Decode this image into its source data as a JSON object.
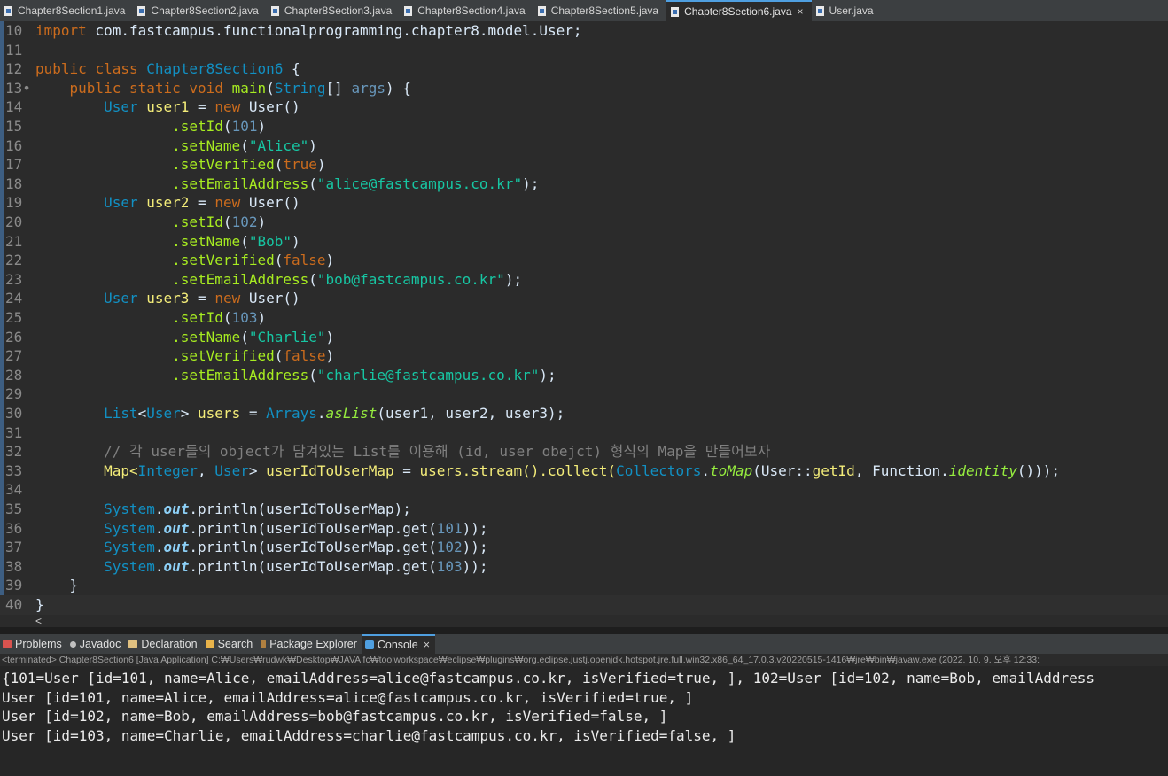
{
  "tabs": [
    {
      "label": "Chapter8Section1.java",
      "active": false
    },
    {
      "label": "Chapter8Section2.java",
      "active": false
    },
    {
      "label": "Chapter8Section3.java",
      "active": false
    },
    {
      "label": "Chapter8Section4.java",
      "active": false
    },
    {
      "label": "Chapter8Section5.java",
      "active": false
    },
    {
      "label": "Chapter8Section6.java",
      "active": true,
      "close": "×"
    },
    {
      "label": "User.java",
      "active": false
    }
  ],
  "editor": {
    "line_numbers": [
      "10",
      "11",
      "12",
      "13•",
      "14",
      "15",
      "16",
      "17",
      "18",
      "19",
      "20",
      "21",
      "22",
      "23",
      "24",
      "25",
      "26",
      "27",
      "28",
      "29",
      "30",
      "31",
      "32",
      "33",
      "34",
      "35",
      "36",
      "37",
      "38",
      "39",
      "40"
    ],
    "code": {
      "l10": {
        "kw": "import",
        "rest": " com.fastcampus.functionalprogramming.chapter8.model.User;"
      },
      "l12": {
        "kw1": "public",
        "kw2": "class",
        "cls": "Chapter8Section6",
        "brace": " {"
      },
      "l13": {
        "kw1": "public",
        "kw2": "static",
        "kw3": "void",
        "meth": "main",
        "p1": "(",
        "cls": "String",
        "p2": "[] ",
        "arg": "args",
        "p3": ") {"
      },
      "l14": {
        "cls": "User",
        "var": "user1",
        "eq": " = ",
        "kw": "new",
        "rest": " User()"
      },
      "l15": {
        "meth": ".setId",
        "p1": "(",
        "num": "101",
        "p2": ")"
      },
      "l16": {
        "meth": ".setName",
        "p1": "(",
        "str": "\"Alice\"",
        "p2": ")"
      },
      "l17": {
        "meth": ".setVerified",
        "p1": "(",
        "kw": "true",
        "p2": ")"
      },
      "l18": {
        "meth": ".setEmailAddress",
        "p1": "(",
        "str": "\"alice@fastcampus.co.kr\"",
        "p2": ");"
      },
      "l19": {
        "cls": "User",
        "var": "user2",
        "eq": " = ",
        "kw": "new",
        "rest": " User()"
      },
      "l20": {
        "meth": ".setId",
        "p1": "(",
        "num": "102",
        "p2": ")"
      },
      "l21": {
        "meth": ".setName",
        "p1": "(",
        "str": "\"Bob\"",
        "p2": ")"
      },
      "l22": {
        "meth": ".setVerified",
        "p1": "(",
        "kw": "false",
        "p2": ")"
      },
      "l23": {
        "meth": ".setEmailAddress",
        "p1": "(",
        "str": "\"bob@fastcampus.co.kr\"",
        "p2": ");"
      },
      "l24": {
        "cls": "User",
        "var": "user3",
        "eq": " = ",
        "kw": "new",
        "rest": " User()"
      },
      "l25": {
        "meth": ".setId",
        "p1": "(",
        "num": "103",
        "p2": ")"
      },
      "l26": {
        "meth": ".setName",
        "p1": "(",
        "str": "\"Charlie\"",
        "p2": ")"
      },
      "l27": {
        "meth": ".setVerified",
        "p1": "(",
        "kw": "false",
        "p2": ")"
      },
      "l28": {
        "meth": ".setEmailAddress",
        "p1": "(",
        "str": "\"charlie@fastcampus.co.kr\"",
        "p2": ");"
      },
      "l30": {
        "cls1": "List",
        "lt": "<",
        "cls2": "User",
        "gt": "> ",
        "var": "users",
        "eq": " = ",
        "cls3": "Arrays",
        "dot": ".",
        "smeth": "asList",
        "rest": "(user1, user2, user3);"
      },
      "l32": {
        "comment": "// 각 user들의 object가 담겨있는 List를 이용해 (id, user obejct) 형식의 Map을 만들어보자"
      },
      "l33": {
        "t1": "Map<",
        "cls1": "Integer",
        "t2": ", ",
        "cls2": "User",
        "t3": "> ",
        "var": "userIdToUserMap",
        "t4": " = ",
        "t5": "users.stream().collect(",
        "cls3": "Collectors",
        "dot": ".",
        "smeth": "toMap",
        "t6": "(User::",
        "meth": "getId",
        "t7": ", Function.",
        "smeth2": "identity",
        "t8": "()));"
      },
      "l35": {
        "cls": "System",
        "dot": ".",
        "field": "out",
        "rest": ".println(userIdToUserMap);"
      },
      "l36": {
        "cls": "System",
        "dot": ".",
        "field": "out",
        "rest": ".println(userIdToUserMap.get(",
        "num": "101",
        "end": "));"
      },
      "l37": {
        "cls": "System",
        "dot": ".",
        "field": "out",
        "rest": ".println(userIdToUserMap.get(",
        "num": "102",
        "end": "));"
      },
      "l38": {
        "cls": "System",
        "dot": ".",
        "field": "out",
        "rest": ".println(userIdToUserMap.get(",
        "num": "103",
        "end": "));"
      },
      "l39": {
        "brace": "}"
      },
      "l40": {
        "brace": "}"
      }
    },
    "hscroll_arrow": "<"
  },
  "views": [
    {
      "label": "Problems",
      "color": "#d9534f"
    },
    {
      "label": "Javadoc",
      "color": "#c0c0c0"
    },
    {
      "label": "Declaration",
      "color": "#e0c080"
    },
    {
      "label": "Search",
      "color": "#e8b34a"
    },
    {
      "label": "Package Explorer",
      "color": "#b08040"
    },
    {
      "label": "Console",
      "color": "#4f9fe0",
      "active": true,
      "close": "×"
    }
  ],
  "console": {
    "status": "<terminated> Chapter8Section6 [Java Application] C:₩Users₩rudwk₩Desktop₩JAVA fc₩toolworkspace₩eclipse₩plugins₩org.eclipse.justj.openjdk.hotspot.jre.full.win32.x86_64_17.0.3.v20220515-1416₩jre₩bin₩javaw.exe  (2022. 10. 9. 오후 12:33:",
    "lines": [
      "{101=User [id=101, name=Alice, emailAddress=alice@fastcampus.co.kr, isVerified=true, ], 102=User [id=102, name=Bob, emailAddress",
      "User [id=101, name=Alice, emailAddress=alice@fastcampus.co.kr, isVerified=true, ]",
      "User [id=102, name=Bob, emailAddress=bob@fastcampus.co.kr, isVerified=false, ]",
      "User [id=103, name=Charlie, emailAddress=charlie@fastcampus.co.kr, isVerified=false, ]"
    ]
  }
}
